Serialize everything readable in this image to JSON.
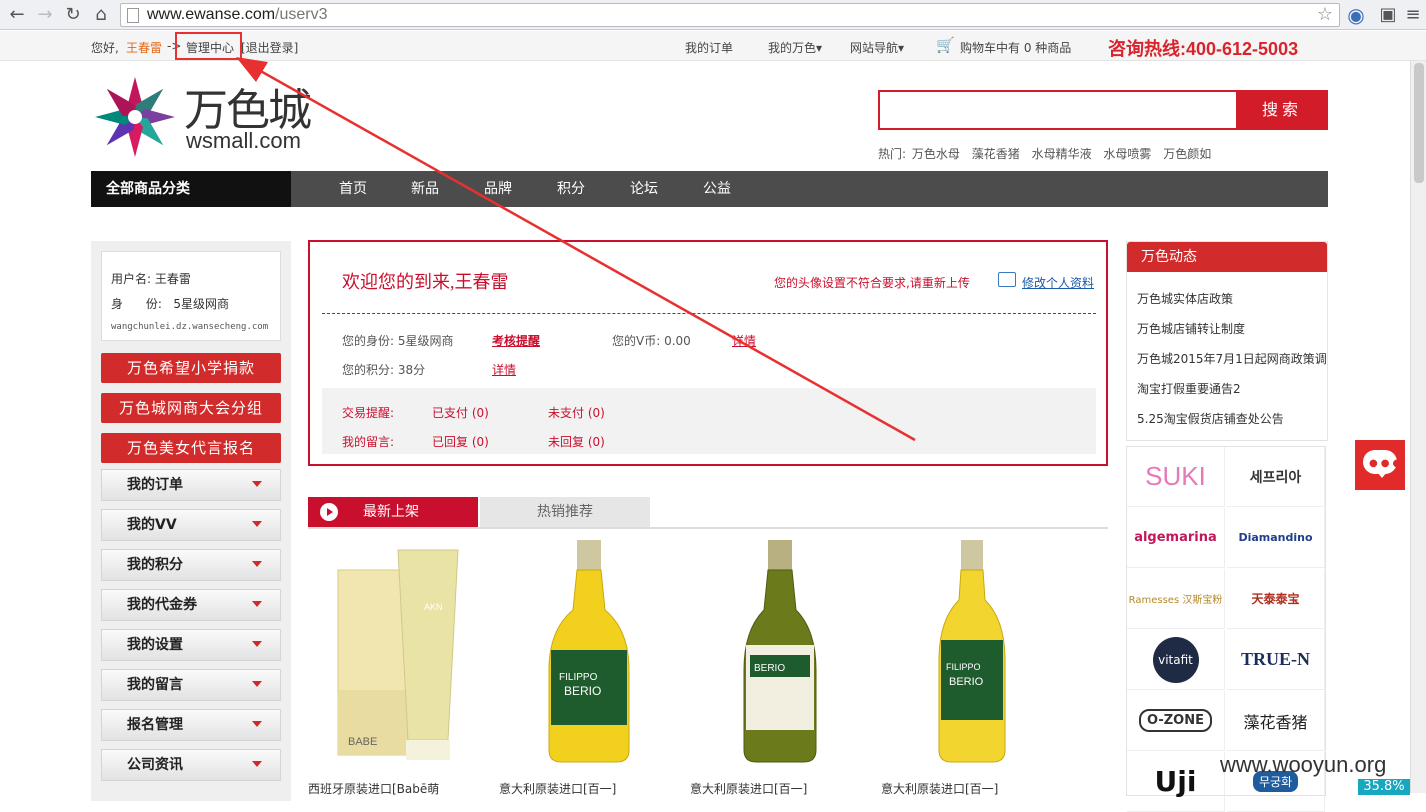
{
  "browser": {
    "url_host": "www.ewanse.com",
    "url_path": "/userv3"
  },
  "topbar": {
    "greeting": "您好,",
    "username": "王春雷",
    "arrow": "->",
    "admin_center": "管理中心",
    "logout": "[退出登录]",
    "my_orders": "我的订单",
    "my_wanse": "我的万色▾",
    "site_nav": "网站导航▾",
    "cart": "购物车中有 0 种商品",
    "hotline": "咨询热线:400-612-5003"
  },
  "header": {
    "logo_cn": "万色城",
    "logo_en": "wsmall.com",
    "search_button": "搜索",
    "search_placeholder": "",
    "hot_label": "热门:",
    "hot_words": [
      "万色水母",
      "藻花香猪",
      "水母精华液",
      "水母喷雾",
      "万色颜如"
    ]
  },
  "nav": {
    "all_categories": "全部商品分类",
    "items": [
      "首页",
      "新品",
      "品牌",
      "积分",
      "论坛",
      "公益"
    ]
  },
  "sidebar": {
    "user_label": "用户名: 王春雷",
    "identity_label": "身      份:   5星级网商",
    "email": "wangchunlei.dz.wansecheng.com",
    "red_buttons": [
      "万色希望小学捐款",
      "万色城网商大会分组",
      "万色美女代言报名"
    ],
    "menu": [
      "我的订单",
      "我的VV",
      "我的积分",
      "我的代金券",
      "我的设置",
      "我的留言",
      "报名管理",
      "公司资讯"
    ]
  },
  "welcome": {
    "title": "欢迎您的到来,王春雷",
    "avatar_warning": "您的头像设置不符合要求,请重新上传",
    "edit_profile": "修改个人资料",
    "identity": "您的身份: 5星级网商",
    "review_link": "考核提醒",
    "vcoin": "您的V币: 0.00",
    "detail1": "详情",
    "points": "您的积分: 38分",
    "detail2": "详情",
    "trade_label": "交易提醒:",
    "paid": "已支付 (0)",
    "unpaid": "未支付 (0)",
    "msg_label": "我的留言:",
    "replied": "已回复 (0)",
    "unreplied": "未回复 (0)"
  },
  "tabs": {
    "new": "最新上架",
    "hot": "热销推荐"
  },
  "products": [
    {
      "name": "西班牙原装进口[Babē萌"
    },
    {
      "name": "意大利原装进口[百一]"
    },
    {
      "name": "意大利原装进口[百一]"
    },
    {
      "name": "意大利原装进口[百一]"
    }
  ],
  "news": {
    "title": "万色动态",
    "items": [
      "万色城实体店政策",
      "万色城店铺转让制度",
      "万色城2015年7月1日起网商政策调",
      "淘宝打假重要通告2",
      "5.25淘宝假货店铺查处公告"
    ]
  },
  "brands": [
    "SUKI",
    "세프리아",
    "algemarina",
    "Diamandino",
    "Ramesses 汉斯宝粉",
    "天泰泰宝",
    "vitafit",
    "TRUE-N",
    "O-ZONE",
    "藻花香猪",
    "Uji",
    "무궁화"
  ],
  "watermark": "www.wooyun.org",
  "zoom": "35.8%",
  "colors": {
    "brand_red": "#d12b2b",
    "nav_dark": "#4c4c4c"
  }
}
